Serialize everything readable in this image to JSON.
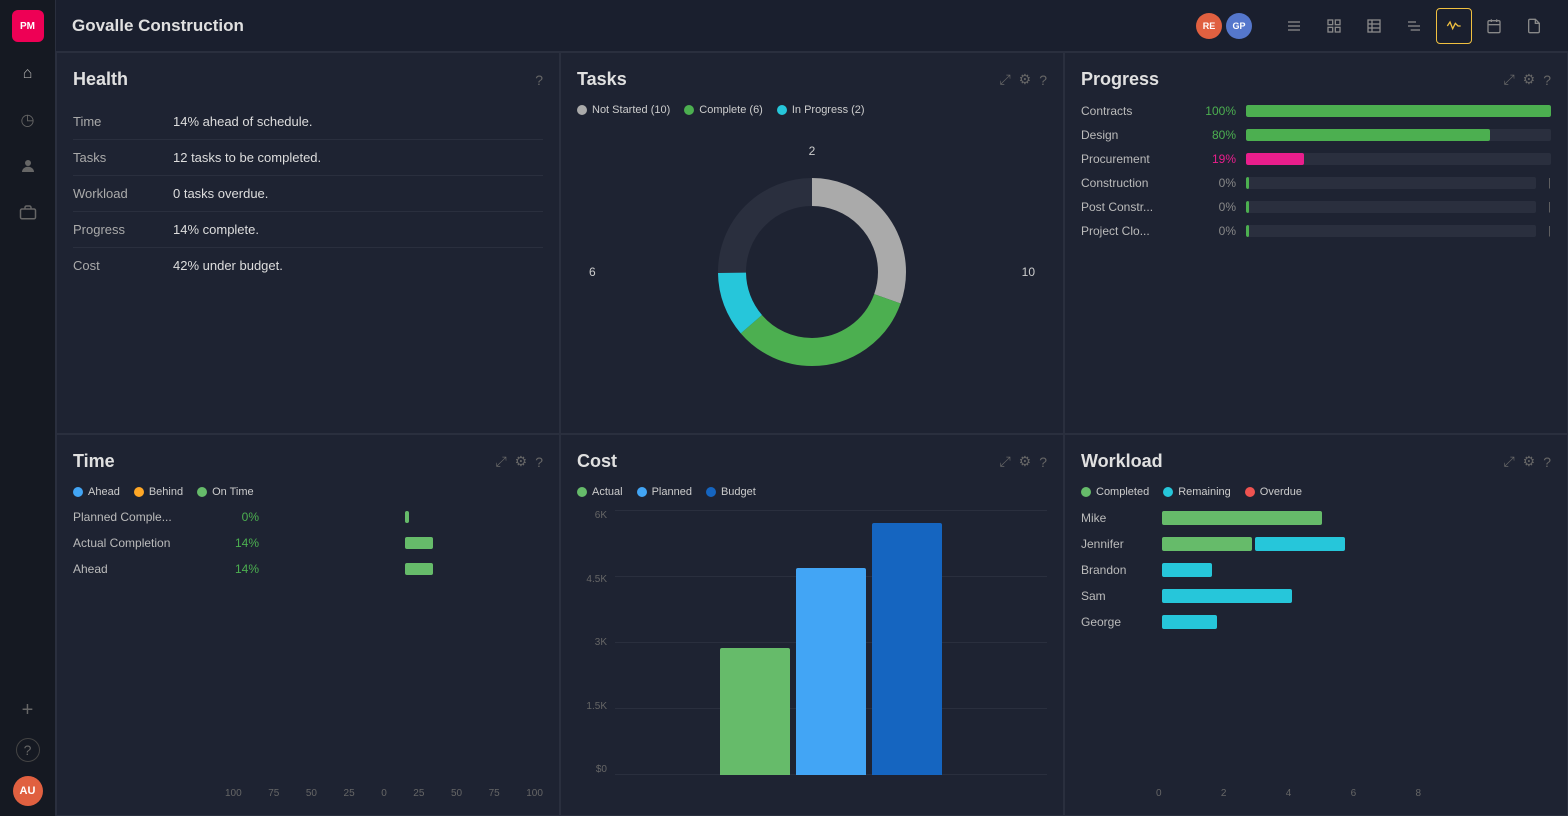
{
  "sidebar": {
    "logo": "PM",
    "nav_items": [
      {
        "icon": "⌂",
        "name": "home",
        "active": false
      },
      {
        "icon": "◷",
        "name": "clock",
        "active": false
      },
      {
        "icon": "👤",
        "name": "person",
        "active": false
      },
      {
        "icon": "💼",
        "name": "briefcase",
        "active": false
      }
    ],
    "bottom_items": [
      {
        "icon": "+",
        "name": "add"
      },
      {
        "icon": "?",
        "name": "help"
      }
    ],
    "avatar": "AU"
  },
  "header": {
    "title": "Govalle Construction",
    "avatars": [
      {
        "initials": "RE",
        "color": "#e06040"
      },
      {
        "initials": "GP",
        "color": "#5577cc"
      }
    ],
    "tools": [
      {
        "icon": "☰",
        "name": "list",
        "active": false
      },
      {
        "icon": "▦",
        "name": "board",
        "active": false
      },
      {
        "icon": "≡",
        "name": "table2",
        "active": false
      },
      {
        "icon": "▤",
        "name": "gantt",
        "active": false
      },
      {
        "icon": "〜",
        "name": "pulse",
        "active": true
      },
      {
        "icon": "📅",
        "name": "calendar",
        "active": false
      },
      {
        "icon": "📄",
        "name": "doc",
        "active": false
      }
    ]
  },
  "health": {
    "title": "Health",
    "rows": [
      {
        "label": "Time",
        "value": "14% ahead of schedule."
      },
      {
        "label": "Tasks",
        "value": "12 tasks to be completed."
      },
      {
        "label": "Workload",
        "value": "0 tasks overdue."
      },
      {
        "label": "Progress",
        "value": "14% complete."
      },
      {
        "label": "Cost",
        "value": "42% under budget."
      }
    ]
  },
  "tasks": {
    "title": "Tasks",
    "legend": [
      {
        "label": "Not Started (10)",
        "color": "#aaaaaa"
      },
      {
        "label": "Complete (6)",
        "color": "#4caf50"
      },
      {
        "label": "In Progress (2)",
        "color": "#26c6da"
      }
    ],
    "donut": {
      "not_started": 10,
      "complete": 6,
      "in_progress": 2,
      "total": 18,
      "label_left": "6",
      "label_right": "10",
      "label_top": "2"
    }
  },
  "progress": {
    "title": "Progress",
    "rows": [
      {
        "name": "Contracts",
        "pct": "100%",
        "fill": 100,
        "color": "#4caf50",
        "pct_color": "green"
      },
      {
        "name": "Design",
        "pct": "80%",
        "fill": 80,
        "color": "#4caf50",
        "pct_color": "green"
      },
      {
        "name": "Procurement",
        "pct": "19%",
        "fill": 19,
        "color": "#e91e8c",
        "pct_color": "pink"
      },
      {
        "name": "Construction",
        "pct": "0%",
        "fill": 0,
        "color": "#4caf50",
        "pct_color": "gray"
      },
      {
        "name": "Post Constr...",
        "pct": "0%",
        "fill": 0,
        "color": "#4caf50",
        "pct_color": "gray"
      },
      {
        "name": "Project Clo...",
        "pct": "0%",
        "fill": 0,
        "color": "#4caf50",
        "pct_color": "gray"
      }
    ]
  },
  "time": {
    "title": "Time",
    "legend": [
      {
        "label": "Ahead",
        "color": "#42a5f5"
      },
      {
        "label": "Behind",
        "color": "#ffa726"
      },
      {
        "label": "On Time",
        "color": "#66bb6a"
      }
    ],
    "rows": [
      {
        "label": "Planned Comple...",
        "pct": "0%",
        "bar_pct": 0,
        "bar_color": "#66bb6a"
      },
      {
        "label": "Actual Completion",
        "pct": "14%",
        "bar_pct": 14,
        "bar_color": "#66bb6a"
      },
      {
        "label": "Ahead",
        "pct": "14%",
        "bar_pct": 14,
        "bar_color": "#66bb6a"
      }
    ],
    "axis": [
      "100",
      "75",
      "50",
      "25",
      "0",
      "25",
      "50",
      "75",
      "100"
    ]
  },
  "cost": {
    "title": "Cost",
    "legend": [
      {
        "label": "Actual",
        "color": "#66bb6a"
      },
      {
        "label": "Planned",
        "color": "#42a5f5"
      },
      {
        "label": "Budget",
        "color": "#1565c0"
      }
    ],
    "y_labels": [
      "6K",
      "4.5K",
      "3K",
      "1.5K",
      "$0"
    ],
    "bars": [
      {
        "label": "",
        "color": "#66bb6a",
        "height_pct": 48
      },
      {
        "label": "",
        "color": "#42a5f5",
        "height_pct": 78
      },
      {
        "label": "",
        "color": "#1565c0",
        "height_pct": 95
      }
    ]
  },
  "workload": {
    "title": "Workload",
    "legend": [
      {
        "label": "Completed",
        "color": "#66bb6a"
      },
      {
        "label": "Remaining",
        "color": "#26c6da"
      },
      {
        "label": "Overdue",
        "color": "#ef5350"
      }
    ],
    "rows": [
      {
        "name": "Mike",
        "completed": 75,
        "remaining": 0,
        "overdue": 0
      },
      {
        "name": "Jennifer",
        "completed": 40,
        "remaining": 40,
        "overdue": 0
      },
      {
        "name": "Brandon",
        "completed": 0,
        "remaining": 22,
        "overdue": 0
      },
      {
        "name": "Sam",
        "completed": 0,
        "remaining": 55,
        "overdue": 0
      },
      {
        "name": "George",
        "completed": 0,
        "remaining": 25,
        "overdue": 0
      }
    ],
    "axis": [
      "0",
      "2",
      "4",
      "6",
      "8"
    ]
  }
}
